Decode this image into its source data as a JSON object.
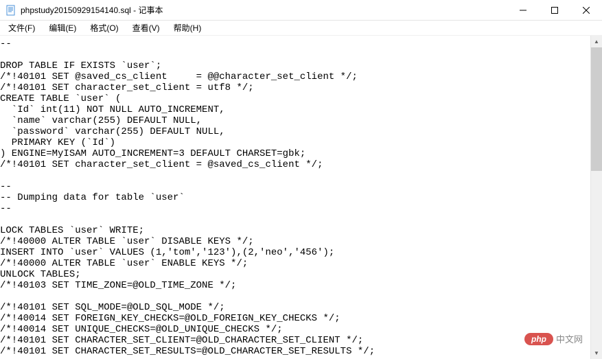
{
  "window": {
    "filename": "phpstudy20150929154140.sql",
    "appname": "记事本",
    "title_separator": " - "
  },
  "menu": {
    "file": "文件(F)",
    "edit": "编辑(E)",
    "format": "格式(O)",
    "view": "查看(V)",
    "help": "帮助(H)"
  },
  "content": "--\n\nDROP TABLE IF EXISTS `user`;\n/*!40101 SET @saved_cs_client     = @@character_set_client */;\n/*!40101 SET character_set_client = utf8 */;\nCREATE TABLE `user` (\n  `Id` int(11) NOT NULL AUTO_INCREMENT,\n  `name` varchar(255) DEFAULT NULL,\n  `password` varchar(255) DEFAULT NULL,\n  PRIMARY KEY (`Id`)\n) ENGINE=MyISAM AUTO_INCREMENT=3 DEFAULT CHARSET=gbk;\n/*!40101 SET character_set_client = @saved_cs_client */;\n\n--\n-- Dumping data for table `user`\n--\n\nLOCK TABLES `user` WRITE;\n/*!40000 ALTER TABLE `user` DISABLE KEYS */;\nINSERT INTO `user` VALUES (1,'tom','123'),(2,'neo','456');\n/*!40000 ALTER TABLE `user` ENABLE KEYS */;\nUNLOCK TABLES;\n/*!40103 SET TIME_ZONE=@OLD_TIME_ZONE */;\n\n/*!40101 SET SQL_MODE=@OLD_SQL_MODE */;\n/*!40014 SET FOREIGN_KEY_CHECKS=@OLD_FOREIGN_KEY_CHECKS */;\n/*!40014 SET UNIQUE_CHECKS=@OLD_UNIQUE_CHECKS */;\n/*!40101 SET CHARACTER_SET_CLIENT=@OLD_CHARACTER_SET_CLIENT */;\n/*!40101 SET CHARACTER_SET_RESULTS=@OLD_CHARACTER_SET_RESULTS */;",
  "watermark": {
    "badge": "php",
    "text": "中文网"
  }
}
